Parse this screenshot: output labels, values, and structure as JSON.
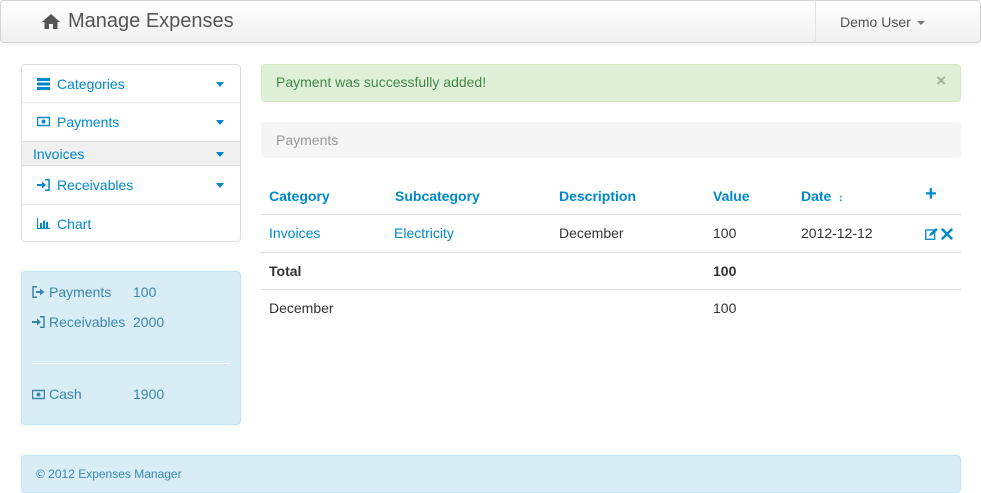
{
  "navbar": {
    "brand": "Manage Expenses",
    "brand_icon": "home-icon",
    "user": "Demo User"
  },
  "sidebar": {
    "items": [
      {
        "label": "Categories",
        "icon": "list-icon"
      },
      {
        "label": "Payments",
        "icon": "money-icon"
      },
      {
        "label": "Invoices"
      },
      {
        "label": "Receivables",
        "icon": "sign-in-icon"
      },
      {
        "label": "Chart",
        "icon": "bar-chart-icon"
      }
    ]
  },
  "summary": {
    "payments_label": "Payments",
    "payments_value": "100",
    "receivables_label": "Receivables",
    "receivables_value": "2000",
    "cash_label": "Cash",
    "cash_value": "1900"
  },
  "alert": {
    "message": "Payment was successfully added!",
    "close": "×"
  },
  "section_title": "Payments",
  "table": {
    "headers": {
      "category": "Category",
      "subcategory": "Subcategory",
      "description": "Description",
      "value": "Value",
      "date": "Date",
      "sort_indicator": "↕",
      "add": "+"
    },
    "rows": [
      {
        "category": "Invoices",
        "subcategory": "Electricity",
        "description": "December",
        "value": "100",
        "date": "2012-12-12"
      }
    ],
    "total": {
      "label": "Total",
      "value": "100"
    },
    "group": {
      "label": "December",
      "value": "100"
    }
  },
  "footer": {
    "text": "© 2012 Expenses Manager"
  },
  "colors": {
    "link": "#0088cc",
    "alert_bg": "#dff0d8",
    "alert_text": "#468847",
    "info_bg": "#d9edf7",
    "info_text": "#3a87ad"
  }
}
